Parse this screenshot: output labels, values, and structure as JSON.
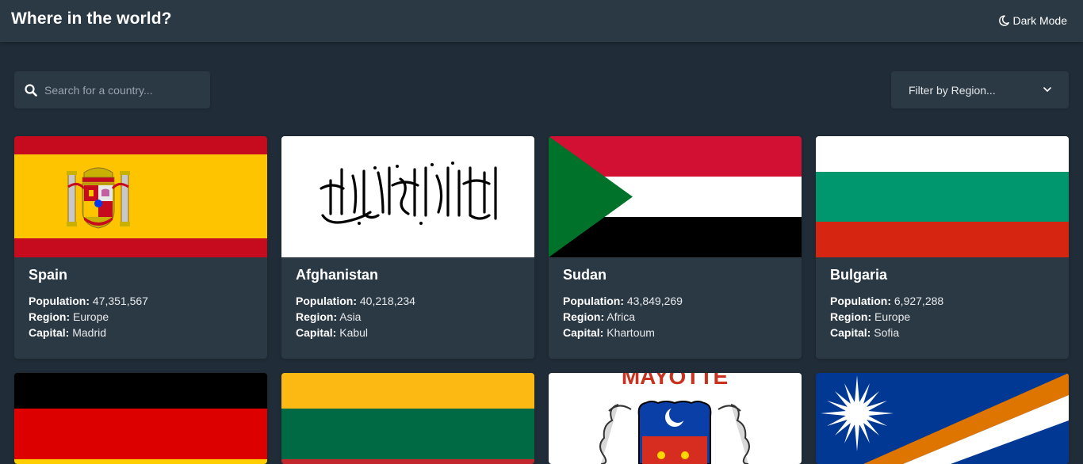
{
  "header": {
    "title": "Where in the world?",
    "dark_mode_label": "Dark Mode",
    "dark_mode_icon": "moon-icon"
  },
  "search": {
    "placeholder": "Search for a country...",
    "value": "",
    "icon": "search-icon"
  },
  "filter": {
    "label": "Filter by Region...",
    "icon": "chevron-down-icon"
  },
  "labels": {
    "population": "Population:",
    "region": "Region:",
    "capital": "Capital:"
  },
  "countries": [
    {
      "name": "Spain",
      "population": "47,351,567",
      "region": "Europe",
      "capital": "Madrid"
    },
    {
      "name": "Afghanistan",
      "population": "40,218,234",
      "region": "Asia",
      "capital": "Kabul"
    },
    {
      "name": "Sudan",
      "population": "43,849,269",
      "region": "Africa",
      "capital": "Khartoum"
    },
    {
      "name": "Bulgaria",
      "population": "6,927,288",
      "region": "Europe",
      "capital": "Sofia"
    }
  ],
  "partial_flags": [
    {
      "flag": "germany-flag"
    },
    {
      "flag": "lithuania-flag"
    },
    {
      "flag": "mayotte-flag",
      "text": "MAYOTTE"
    },
    {
      "flag": "marshall-islands-flag"
    }
  ],
  "colors": {
    "background": "#202c37",
    "element": "#2b3945",
    "text": "#ffffff"
  }
}
